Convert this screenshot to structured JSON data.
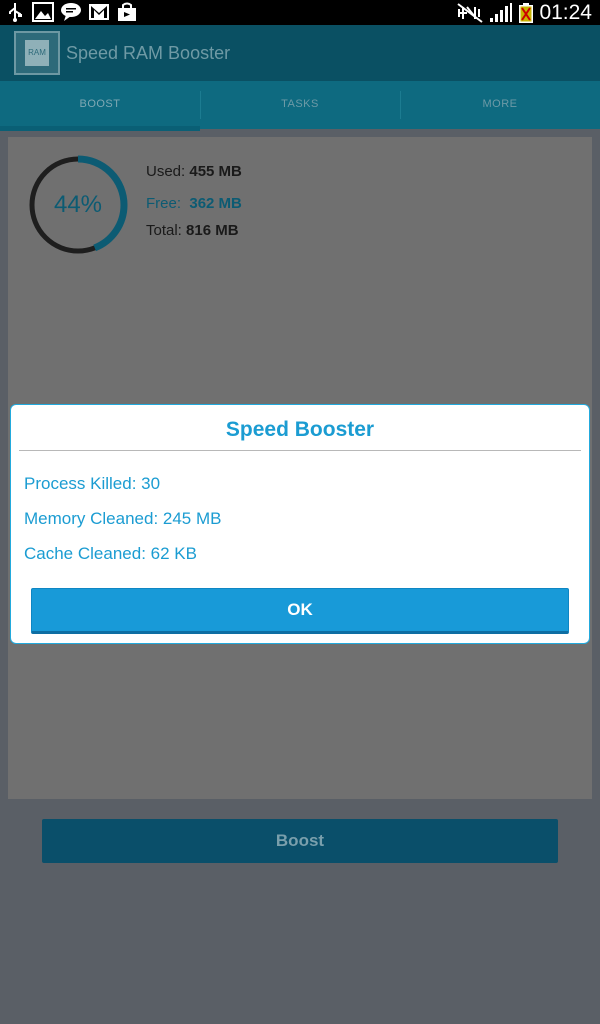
{
  "status_bar": {
    "time": "01:24",
    "icons": [
      "usb-icon",
      "gallery-icon",
      "chat-icon",
      "gmail-icon",
      "shopping-bag-icon",
      "mute-icon",
      "signal-icon",
      "battery-icon"
    ]
  },
  "app_bar": {
    "logo_text": "RAM",
    "title": "Speed RAM Booster"
  },
  "tabs": [
    {
      "label": "BOOST",
      "active": true
    },
    {
      "label": "TASKS",
      "active": false
    },
    {
      "label": "MORE",
      "active": false
    }
  ],
  "memory": {
    "percent_label": "44%",
    "percent_value": 0.44,
    "used_label": "Used:",
    "used_value": "455 MB",
    "free_label": "Free:",
    "free_value": "362 MB",
    "total_label": "Total:",
    "total_value": "816 MB"
  },
  "boost_button": "Boost",
  "dialog": {
    "title": "Speed Booster",
    "lines": [
      "Process Killed: 30",
      "Memory Cleaned: 245 MB",
      "Cache Cleaned: 62 KB"
    ],
    "ok_label": "OK"
  },
  "colors": {
    "accent": "#1b9cd2",
    "app_bar": "#0a5063",
    "overlay_bg": "#5a5f66"
  }
}
